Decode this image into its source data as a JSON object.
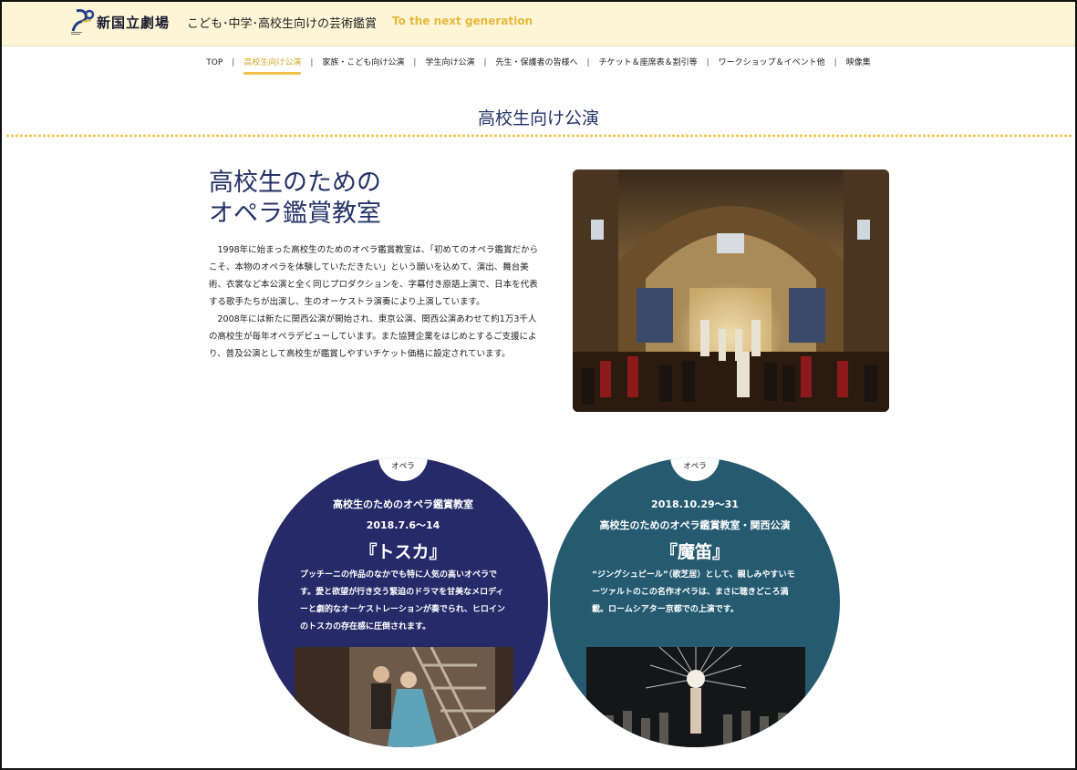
{
  "header": {
    "logo_text": "新国立劇場",
    "site_title": "こども･中学･高校生向けの芸術鑑賞",
    "tagline": "To the next generation"
  },
  "nav": {
    "items": [
      {
        "label": "TOP",
        "active": false
      },
      {
        "label": "高校生向け公演",
        "active": true
      },
      {
        "label": "家族・こども向け公演",
        "active": false
      },
      {
        "label": "学生向け公演",
        "active": false
      },
      {
        "label": "先生・保護者の皆様へ",
        "active": false
      },
      {
        "label": "チケット＆座席表＆割引等",
        "active": false
      },
      {
        "label": "ワークショップ＆イベント他",
        "active": false
      },
      {
        "label": "映像集",
        "active": false
      }
    ],
    "separator": "|"
  },
  "page": {
    "title": "高校生向け公演"
  },
  "intro": {
    "heading_line1": "高校生のための",
    "heading_line2": "オペラ鑑賞教室",
    "paragraph1": "1998年に始まった高校生のためのオペラ鑑賞教室は、「初めてのオペラ鑑賞だからこそ、本物のオペラを体験していただきたい」という願いを込めて、演出、舞台美術、衣裳など本公演と全く同じプロダクションを、字幕付き原語上演で、日本を代表する歌手たちが出演し、生のオーケストラ演奏により上演しています。",
    "paragraph2": "2008年には新たに関西公演が開始され、東京公演、関西公演あわせて約1万3千人の高校生が毎年オペラデビューしています。また協賛企業をはじめとするご支援により、普及公演として高校生が鑑賞しやすいチケット価格に設定されています。"
  },
  "cards": [
    {
      "category": "オペラ",
      "line1": "高校生のためのオペラ鑑賞教室",
      "line2": "2018.7.6～14",
      "title": "『トスカ』",
      "description": "プッチーニの作品のなかでも特に人気の高いオペラです。愛と欲望が行き交う緊迫のドラマを甘美なメロディーと劇的なオーケストレーションが奏でられ、ヒロインのトスカの存在感に圧倒されます。",
      "color": "#262a69"
    },
    {
      "category": "オペラ",
      "line1": "2018.10.29～31",
      "line2": "高校生のためのオペラ鑑賞教室・関西公演",
      "title": "『魔笛』",
      "description": "“ジングシュピール”（歌芝居）として、親しみやすいモーツァルトのこの名作オペラは、まさに聴きどころ満載。ロームシアター京都での上演です。",
      "color": "#255a70"
    }
  ],
  "colors": {
    "header_bg": "#fdf5d6",
    "accent_gold": "#f0c34a",
    "navy": "#243367"
  }
}
